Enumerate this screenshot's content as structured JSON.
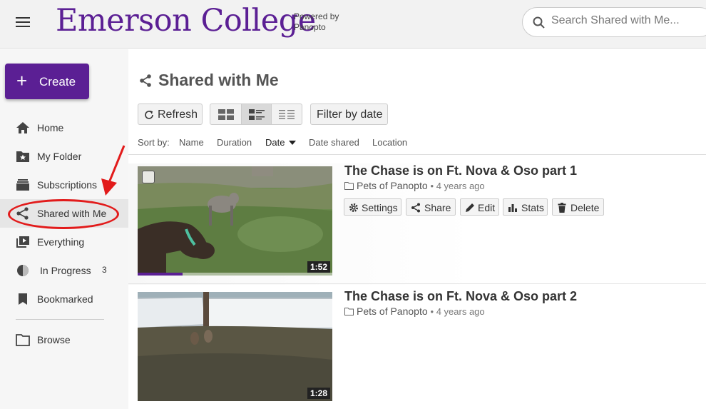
{
  "header": {
    "brand": "Emerson College",
    "powered_line1": "Powered by",
    "powered_line2": "Panopto",
    "search_placeholder": "Search Shared with Me..."
  },
  "sidebar": {
    "create_label": "Create",
    "items": [
      {
        "label": "Home",
        "icon": "home-icon"
      },
      {
        "label": "My Folder",
        "icon": "star-folder-icon"
      },
      {
        "label": "Subscriptions",
        "icon": "subscriptions-icon"
      },
      {
        "label": "Shared with Me",
        "icon": "share-icon",
        "active": true
      },
      {
        "label": "Everything",
        "icon": "play-library-icon"
      },
      {
        "label": "In Progress",
        "icon": "half-circle-icon",
        "count": "3"
      },
      {
        "label": "Bookmarked",
        "icon": "bookmark-icon"
      },
      {
        "label": "Browse",
        "icon": "folder-icon"
      }
    ]
  },
  "main": {
    "title": "Shared with Me",
    "refresh_label": "Refresh",
    "filter_label": "Filter by date",
    "sort": {
      "prefix": "Sort by:",
      "options": [
        "Name",
        "Duration",
        "Date",
        "Date shared",
        "Location"
      ],
      "current": "Date"
    }
  },
  "sessions": [
    {
      "title": "The Chase is on Ft. Nova & Oso part 1",
      "folder": "Pets of Panopto",
      "ago": "4 years ago",
      "duration": "1:52",
      "progress": 0.23,
      "actions": [
        "Settings",
        "Share",
        "Edit",
        "Stats",
        "Delete"
      ]
    },
    {
      "title": "The Chase is on Ft. Nova & Oso part 2",
      "folder": "Pets of Panopto",
      "ago": "4 years ago",
      "duration": "1:28"
    }
  ],
  "annotation_color": "#e21b1b",
  "accent_color": "#5b1f94"
}
